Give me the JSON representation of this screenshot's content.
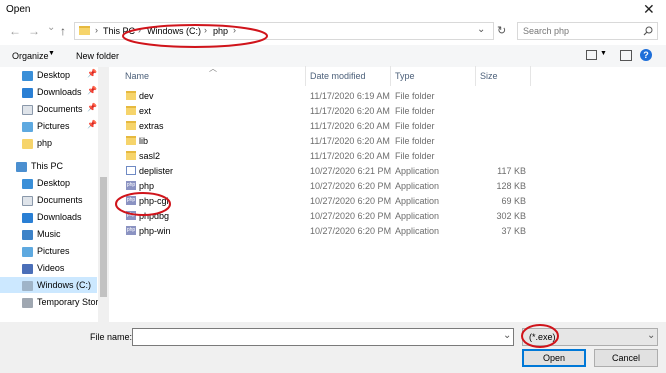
{
  "window": {
    "title": "Open"
  },
  "nav": {
    "back_label": "←",
    "forward_label": "→",
    "dropdown_label": "⌄",
    "up_label": "↑",
    "refresh_label": "↻"
  },
  "breadcrumb": [
    {
      "label": "This PC"
    },
    {
      "label": "Windows (C:)"
    },
    {
      "label": "php"
    }
  ],
  "search": {
    "placeholder": "Search php"
  },
  "toolbar": {
    "organize_label": "Organize",
    "new_folder_label": "New folder"
  },
  "sidebar": {
    "items": [
      {
        "label": "Desktop",
        "icon": "desktop-icon",
        "pinned": true
      },
      {
        "label": "Downloads",
        "icon": "download-icon",
        "pinned": true
      },
      {
        "label": "Documents",
        "icon": "document-icon",
        "pinned": true
      },
      {
        "label": "Pictures",
        "icon": "pictures-icon",
        "pinned": true
      },
      {
        "label": "php",
        "icon": "folder-icon",
        "pinned": false
      },
      {
        "label": "This PC",
        "icon": "computer-icon",
        "pinned": false
      },
      {
        "label": "Desktop",
        "icon": "desktop-icon",
        "pinned": false
      },
      {
        "label": "Documents",
        "icon": "document-icon",
        "pinned": false
      },
      {
        "label": "Downloads",
        "icon": "download-icon",
        "pinned": false
      },
      {
        "label": "Music",
        "icon": "music-icon",
        "pinned": false
      },
      {
        "label": "Pictures",
        "icon": "pictures-icon",
        "pinned": false
      },
      {
        "label": "Videos",
        "icon": "videos-icon",
        "pinned": false
      },
      {
        "label": "Windows (C:)",
        "icon": "drive-icon",
        "pinned": false
      },
      {
        "label": "Temporary Stora",
        "icon": "drive-icon",
        "pinned": false
      }
    ]
  },
  "columns": {
    "name": "Name",
    "date": "Date modified",
    "type": "Type",
    "size": "Size"
  },
  "files": [
    {
      "name": "dev",
      "date": "11/17/2020 6:19 AM",
      "type": "File folder",
      "size": "",
      "kind": "folder"
    },
    {
      "name": "ext",
      "date": "11/17/2020 6:20 AM",
      "type": "File folder",
      "size": "",
      "kind": "folder"
    },
    {
      "name": "extras",
      "date": "11/17/2020 6:20 AM",
      "type": "File folder",
      "size": "",
      "kind": "folder"
    },
    {
      "name": "lib",
      "date": "11/17/2020 6:20 AM",
      "type": "File folder",
      "size": "",
      "kind": "folder"
    },
    {
      "name": "sasl2",
      "date": "11/17/2020 6:20 AM",
      "type": "File folder",
      "size": "",
      "kind": "folder"
    },
    {
      "name": "deplister",
      "date": "10/27/2020 6:21 PM",
      "type": "Application",
      "size": "117 KB",
      "kind": "app"
    },
    {
      "name": "php",
      "date": "10/27/2020 6:20 PM",
      "type": "Application",
      "size": "128 KB",
      "kind": "php"
    },
    {
      "name": "php-cgi",
      "date": "10/27/2020 6:20 PM",
      "type": "Application",
      "size": "69 KB",
      "kind": "php"
    },
    {
      "name": "phpdbg",
      "date": "10/27/2020 6:20 PM",
      "type": "Application",
      "size": "302 KB",
      "kind": "php"
    },
    {
      "name": "php-win",
      "date": "10/27/2020 6:20 PM",
      "type": "Application",
      "size": "37 KB",
      "kind": "php"
    }
  ],
  "footer": {
    "file_name_label": "File name:",
    "file_name_value": "",
    "filter_value": "(*.exe)",
    "open_label": "Open",
    "cancel_label": "Cancel"
  },
  "colors": {
    "annotation": "#d0141b",
    "accent": "#0078d7",
    "folder": "#f6d46b"
  }
}
